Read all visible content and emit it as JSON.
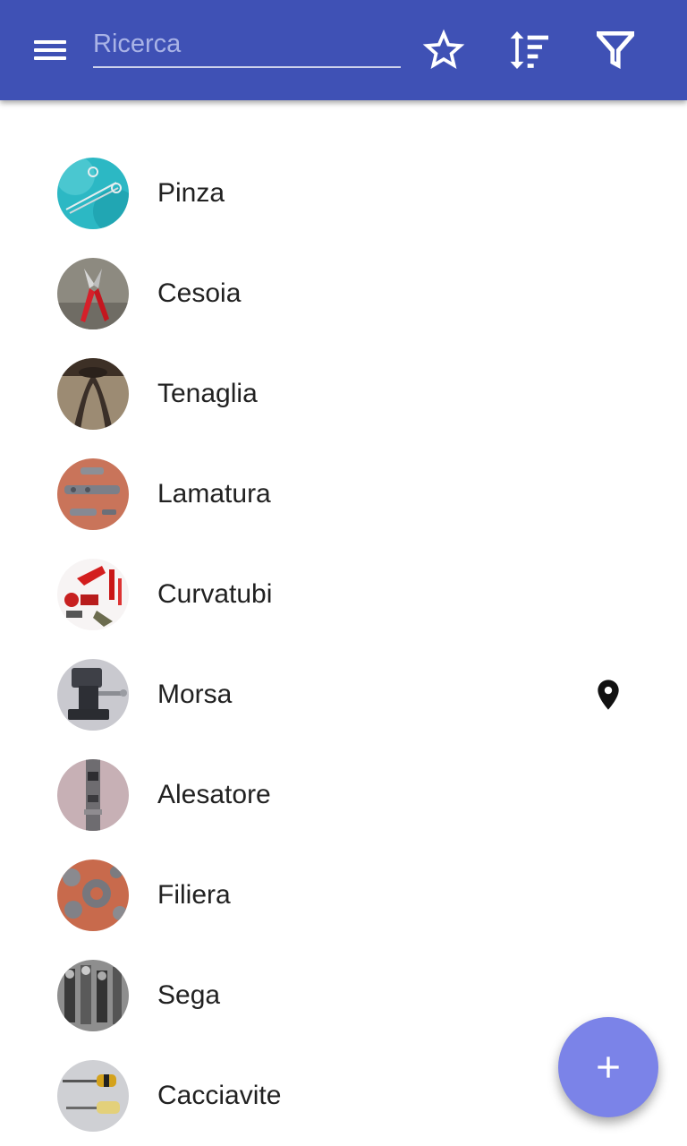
{
  "app_bar": {
    "search_placeholder": "Ricerca",
    "search_value": "",
    "icons": [
      "menu-icon",
      "star-outline-icon",
      "sort-icon",
      "filter-icon"
    ],
    "background_color": "#3f51b5"
  },
  "list": {
    "items": [
      {
        "label": "Pinza",
        "thumbnail": "pliers-photo",
        "has_location": false
      },
      {
        "label": "Cesoia",
        "thumbnail": "pruning-shears-photo",
        "has_location": false
      },
      {
        "label": "Tenaglia",
        "thumbnail": "pincers-photo",
        "has_location": false
      },
      {
        "label": "Lamatura",
        "thumbnail": "counterbore-tools-photo",
        "has_location": false
      },
      {
        "label": "Curvatubi",
        "thumbnail": "pipe-bender-photo",
        "has_location": false
      },
      {
        "label": "Morsa",
        "thumbnail": "bench-vise-photo",
        "has_location": true,
        "trailing_icon": "map-marker-icon"
      },
      {
        "label": "Alesatore",
        "thumbnail": "reamer-photo",
        "has_location": false
      },
      {
        "label": "Filiera",
        "thumbnail": "threading-dies-photo",
        "has_location": false
      },
      {
        "label": "Sega",
        "thumbnail": "saw-photo",
        "has_location": false
      },
      {
        "label": "Cacciavite",
        "thumbnail": "screwdrivers-photo",
        "has_location": false
      }
    ]
  },
  "fab": {
    "icon": "plus-icon",
    "color": "#7b83e8"
  }
}
